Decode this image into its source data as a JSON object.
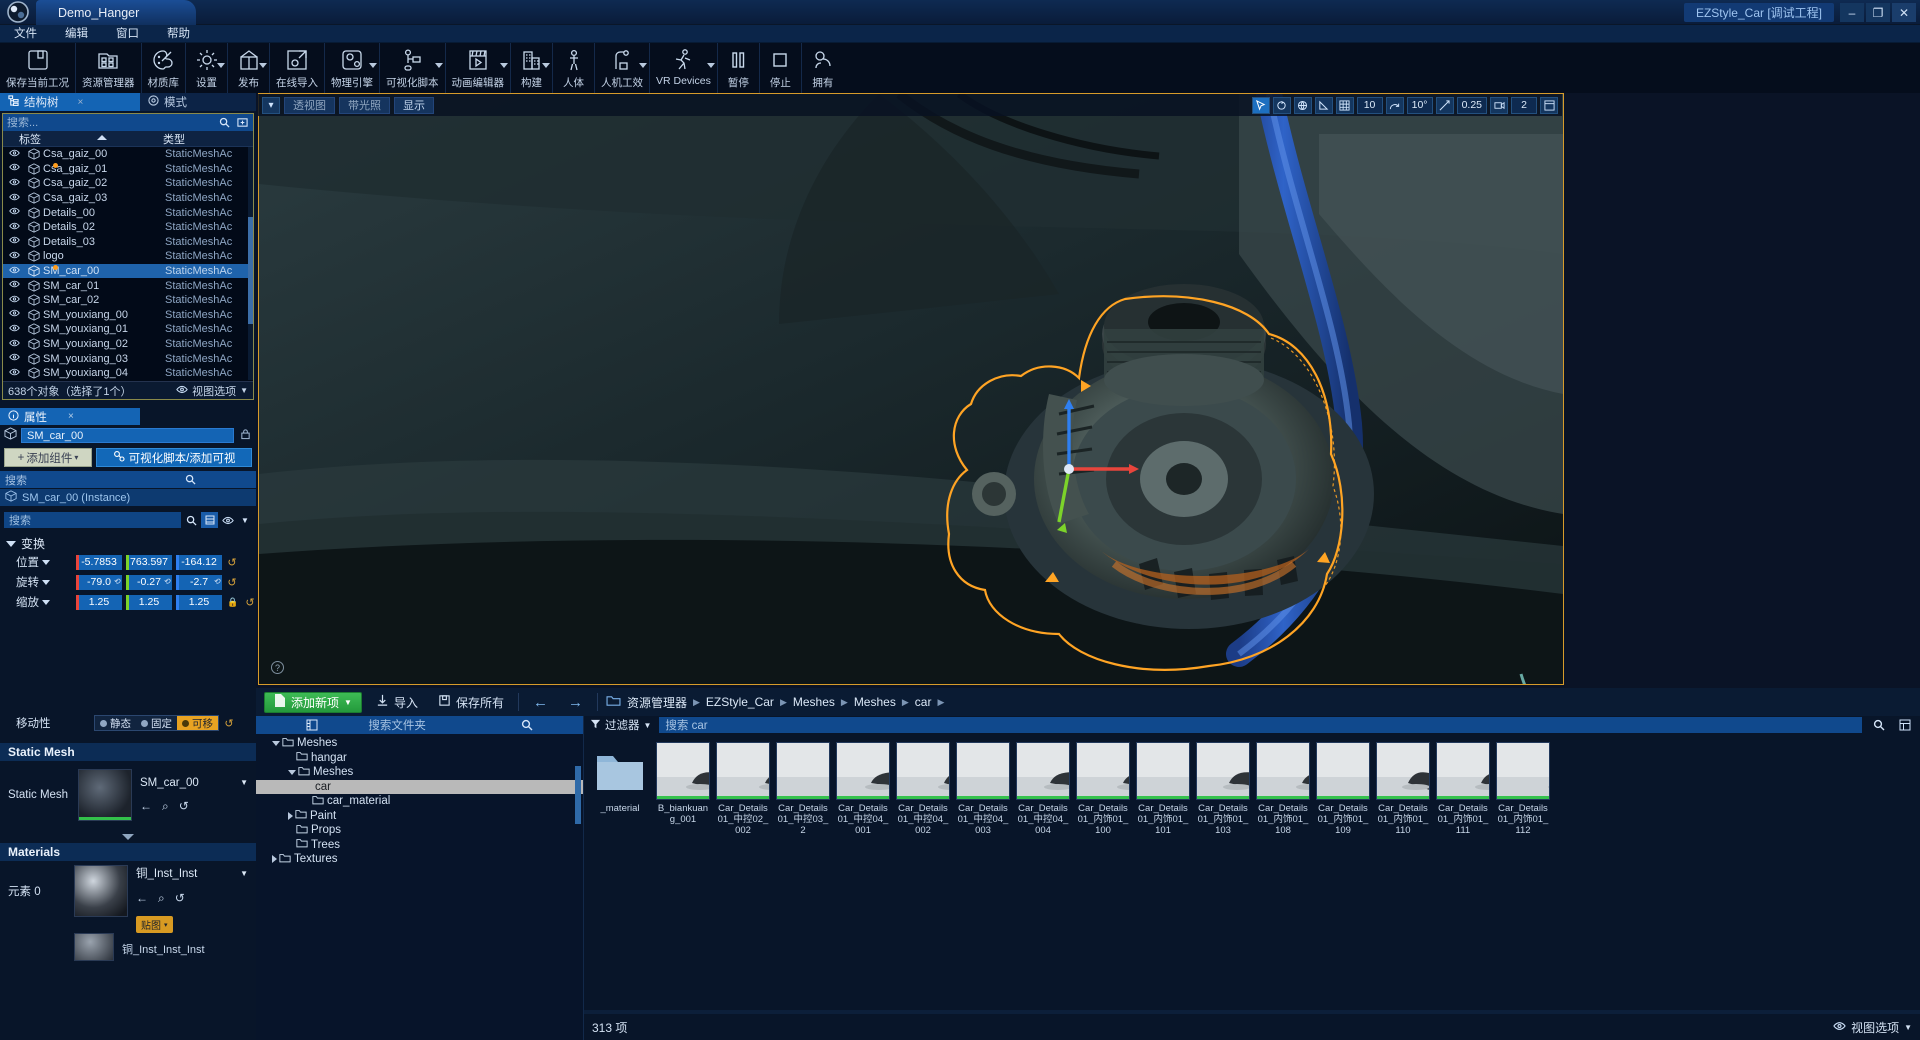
{
  "titlebar": {
    "tab_title": "Demo_Hanger",
    "project_label": "EZStyle_Car [调试工程]",
    "minimize": "–",
    "maximize": "❐",
    "close": "✕"
  },
  "menubar": {
    "items": [
      "文件",
      "编辑",
      "窗口",
      "帮助"
    ]
  },
  "toolbar": {
    "items": [
      {
        "label": "保存当前工况",
        "icon": "save-icon",
        "caret": false
      },
      {
        "label": "资源管理器",
        "icon": "assets-icon",
        "caret": false
      },
      {
        "label": "材质库",
        "icon": "palette-icon",
        "caret": false
      },
      {
        "label": "设置",
        "icon": "gear-icon",
        "caret": true
      },
      {
        "label": "发布",
        "icon": "gift-icon",
        "caret": true
      },
      {
        "label": "在线导入",
        "icon": "import-at-icon",
        "caret": false
      },
      {
        "label": "物理引擎",
        "icon": "physics-icon",
        "caret": true
      },
      {
        "label": "可视化脚本",
        "icon": "script-node-icon",
        "caret": true
      },
      {
        "label": "动画编辑器",
        "icon": "animation-icon",
        "caret": true
      },
      {
        "label": "构建",
        "icon": "building-icon",
        "caret": true
      },
      {
        "label": "人体",
        "icon": "person-icon",
        "caret": false
      },
      {
        "label": "人机工效",
        "icon": "ergonomics-icon",
        "caret": true
      },
      {
        "label": "VR Devices",
        "icon": "vr-run-icon",
        "caret": true
      },
      {
        "label": "暂停",
        "icon": "pause-icon",
        "caret": false
      },
      {
        "label": "停止",
        "icon": "stop-icon",
        "caret": false
      },
      {
        "label": "拥有",
        "icon": "own-icon",
        "caret": false
      }
    ]
  },
  "left_panel": {
    "tabs": [
      {
        "label": "结构树",
        "icon": "tree-icon",
        "active": true,
        "close": "×"
      },
      {
        "label": "模式",
        "icon": "mode-icon",
        "active": false
      }
    ],
    "search_placeholder": "搜索...",
    "columns": {
      "name": "标签",
      "type": "类型"
    },
    "rows": [
      {
        "name": "Csa_gaiz_00",
        "type": "StaticMeshAc",
        "selected": false,
        "dot": false
      },
      {
        "name": "Csa_gaiz_01",
        "type": "StaticMeshAc",
        "selected": false,
        "dot": true
      },
      {
        "name": "Csa_gaiz_02",
        "type": "StaticMeshAc",
        "selected": false,
        "dot": false
      },
      {
        "name": "Csa_gaiz_03",
        "type": "StaticMeshAc",
        "selected": false,
        "dot": false
      },
      {
        "name": "Details_00",
        "type": "StaticMeshAc",
        "selected": false,
        "dot": false
      },
      {
        "name": "Details_02",
        "type": "StaticMeshAc",
        "selected": false,
        "dot": false
      },
      {
        "name": "Details_03",
        "type": "StaticMeshAc",
        "selected": false,
        "dot": false
      },
      {
        "name": "logo",
        "type": "StaticMeshAc",
        "selected": false,
        "dot": false
      },
      {
        "name": "SM_car_00",
        "type": "StaticMeshAc",
        "selected": true,
        "dot": true
      },
      {
        "name": "SM_car_01",
        "type": "StaticMeshAc",
        "selected": false,
        "dot": false
      },
      {
        "name": "SM_car_02",
        "type": "StaticMeshAc",
        "selected": false,
        "dot": false
      },
      {
        "name": "SM_youxiang_00",
        "type": "StaticMeshAc",
        "selected": false,
        "dot": false
      },
      {
        "name": "SM_youxiang_01",
        "type": "StaticMeshAc",
        "selected": false,
        "dot": false
      },
      {
        "name": "SM_youxiang_02",
        "type": "StaticMeshAc",
        "selected": false,
        "dot": false
      },
      {
        "name": "SM_youxiang_03",
        "type": "StaticMeshAc",
        "selected": false,
        "dot": false
      },
      {
        "name": "SM_youxiang_04",
        "type": "StaticMeshAc",
        "selected": false,
        "dot": false
      }
    ],
    "footer_count": "638个对象（选择了1个）",
    "footer_view_options": "视图选项"
  },
  "properties": {
    "tab_label": "属性",
    "tab_close": "×",
    "object_name": "SM_car_00",
    "add_component_label": "添加组件",
    "visual_script_label": "可视化脚本/添加可视",
    "component_search_placeholder": "搜索",
    "instance_label": "SM_car_00 (Instance)",
    "detail_search_placeholder": "搜索",
    "transform": {
      "section_label": "变换",
      "rows": [
        {
          "label": "位置",
          "x": "-5.7853",
          "y": "763.597",
          "z": "-164.12"
        },
        {
          "label": "旋转",
          "x": "-79.0",
          "y": "-0.27",
          "z": "-2.7"
        },
        {
          "label": "缩放",
          "x": "1.25",
          "y": "1.25",
          "z": "1.25"
        }
      ],
      "mobility_label": "移动性",
      "mobility_options": [
        "静态",
        "固定",
        "可移"
      ],
      "mobility_selected": "可移"
    },
    "static_mesh": {
      "section_label": "Static Mesh",
      "field_label": "Static Mesh",
      "value": "SM_car_00"
    },
    "materials": {
      "section_label": "Materials",
      "slot_label": "元素 0",
      "value": "铜_Inst_Inst",
      "badge": "贴图",
      "value2": "铜_Inst_Inst_Inst"
    }
  },
  "viewport": {
    "tabs": [
      "透视图",
      "带光照",
      "显示"
    ],
    "grid_snap": "10",
    "rot_snap": "10°",
    "scale_snap": "0.25",
    "camera_speed": "2"
  },
  "browser": {
    "add_new_label": "添加新项",
    "import_label": "导入",
    "save_all_label": "保存所有",
    "breadcrumb": [
      "资源管理器",
      "EZStyle_Car",
      "Meshes",
      "Meshes",
      "car"
    ],
    "folder_search_placeholder": "搜索文件夹",
    "filter_label": "过滤器",
    "asset_search_placeholder": "搜索 car",
    "folder_tree": [
      {
        "label": "Meshes",
        "depth": 1,
        "tri": "open",
        "selected": false
      },
      {
        "label": "hangar",
        "depth": 2,
        "tri": "none",
        "selected": false
      },
      {
        "label": "Meshes",
        "depth": 2,
        "tri": "open",
        "selected": false
      },
      {
        "label": "car",
        "depth": 3,
        "tri": "none",
        "selected": true
      },
      {
        "label": "car_material",
        "depth": 3,
        "tri": "none",
        "selected": false
      },
      {
        "label": "Paint",
        "depth": 2,
        "tri": "closed",
        "selected": false
      },
      {
        "label": "Props",
        "depth": 2,
        "tri": "none",
        "selected": false
      },
      {
        "label": "Trees",
        "depth": 2,
        "tri": "none",
        "selected": false
      },
      {
        "label": "Textures",
        "depth": 1,
        "tri": "closed",
        "selected": false
      }
    ],
    "assets": [
      {
        "name": "_material",
        "kind": "folder"
      },
      {
        "name": "B_biankuang_001",
        "kind": "mesh"
      },
      {
        "name": "Car_Details01_中控02_002",
        "kind": "mesh"
      },
      {
        "name": "Car_Details01_中控03_2",
        "kind": "mesh"
      },
      {
        "name": "Car_Details01_中控04_001",
        "kind": "mesh"
      },
      {
        "name": "Car_Details01_中控04_002",
        "kind": "mesh"
      },
      {
        "name": "Car_Details01_中控04_003",
        "kind": "mesh"
      },
      {
        "name": "Car_Details01_中控04_004",
        "kind": "mesh"
      },
      {
        "name": "Car_Details01_内饰01_100",
        "kind": "mesh"
      },
      {
        "name": "Car_Details01_内饰01_101",
        "kind": "mesh"
      },
      {
        "name": "Car_Details01_内饰01_103",
        "kind": "mesh"
      },
      {
        "name": "Car_Details01_内饰01_108",
        "kind": "mesh"
      },
      {
        "name": "Car_Details01_内饰01_109",
        "kind": "mesh"
      },
      {
        "name": "Car_Details01_内饰01_110",
        "kind": "mesh"
      },
      {
        "name": "Car_Details01_内饰01_111",
        "kind": "mesh"
      },
      {
        "name": "Car_Details01_内饰01_112",
        "kind": "mesh"
      }
    ],
    "item_count": "313 项",
    "view_options": "视图选项"
  },
  "colors": {
    "accent_blue": "#1464b4",
    "selection_orange": "#d79b2a",
    "green_button": "#2faa46",
    "axis_x": "#e8453c",
    "axis_y": "#7cd32a",
    "axis_z": "#2f7ff0"
  }
}
